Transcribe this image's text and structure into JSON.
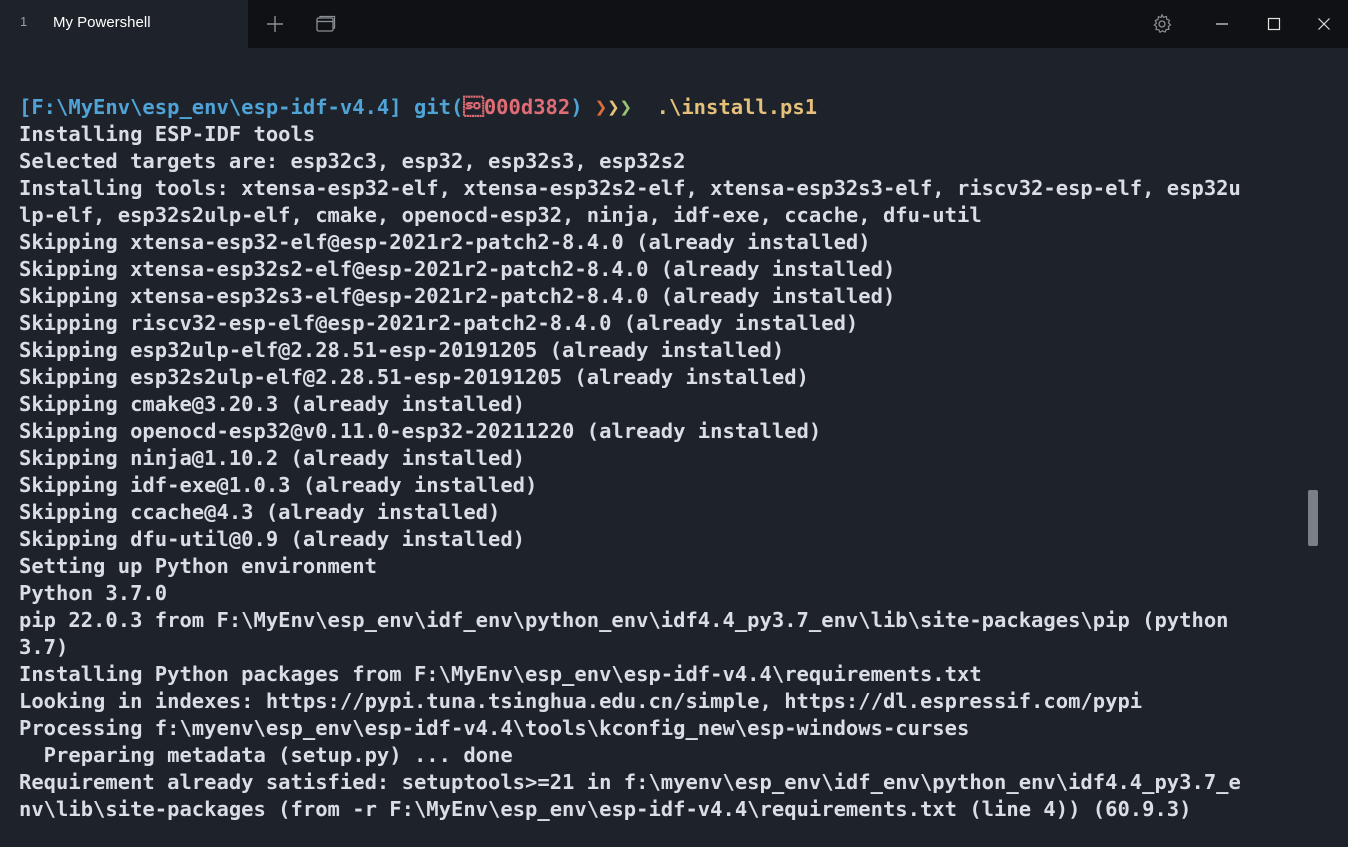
{
  "tab": {
    "index": "1",
    "title": "My Powershell"
  },
  "titlebar_icons": [
    "plus-icon",
    "new-window-icon",
    "gear-icon",
    "minimize-icon",
    "maximize-icon",
    "close-icon"
  ],
  "prompt": {
    "path": "[F:\\MyEnv\\esp_env\\esp-idf-v4.4]",
    "branch_prefix": " git(",
    "branch_hash": "\u000e000d382",
    "branch_suffix": ")",
    "arrow1": " ❯",
    "arrow2": "❯",
    "arrow3": "❯",
    "command": "  .\\install.ps1"
  },
  "output_lines": [
    "Installing ESP-IDF tools",
    "Selected targets are: esp32c3, esp32, esp32s3, esp32s2",
    "Installing tools: xtensa-esp32-elf, xtensa-esp32s2-elf, xtensa-esp32s3-elf, riscv32-esp-elf, esp32u",
    "lp-elf, esp32s2ulp-elf, cmake, openocd-esp32, ninja, idf-exe, ccache, dfu-util",
    "Skipping xtensa-esp32-elf@esp-2021r2-patch2-8.4.0 (already installed)",
    "Skipping xtensa-esp32s2-elf@esp-2021r2-patch2-8.4.0 (already installed)",
    "Skipping xtensa-esp32s3-elf@esp-2021r2-patch2-8.4.0 (already installed)",
    "Skipping riscv32-esp-elf@esp-2021r2-patch2-8.4.0 (already installed)",
    "Skipping esp32ulp-elf@2.28.51-esp-20191205 (already installed)",
    "Skipping esp32s2ulp-elf@2.28.51-esp-20191205 (already installed)",
    "Skipping cmake@3.20.3 (already installed)",
    "Skipping openocd-esp32@v0.11.0-esp32-20211220 (already installed)",
    "Skipping ninja@1.10.2 (already installed)",
    "Skipping idf-exe@1.0.3 (already installed)",
    "Skipping ccache@4.3 (already installed)",
    "Skipping dfu-util@0.9 (already installed)",
    "Setting up Python environment",
    "Python 3.7.0",
    "pip 22.0.3 from F:\\MyEnv\\esp_env\\idf_env\\python_env\\idf4.4_py3.7_env\\lib\\site-packages\\pip (python",
    "3.7)",
    "Installing Python packages from F:\\MyEnv\\esp_env\\esp-idf-v4.4\\requirements.txt",
    "Looking in indexes: https://pypi.tuna.tsinghua.edu.cn/simple, https://dl.espressif.com/pypi",
    "Processing f:\\myenv\\esp_env\\esp-idf-v4.4\\tools\\kconfig_new\\esp-windows-curses",
    "  Preparing metadata (setup.py) ... done",
    "Requirement already satisfied: setuptools>=21 in f:\\myenv\\esp_env\\idf_env\\python_env\\idf4.4_py3.7_e",
    "nv\\lib\\site-packages (from -r F:\\MyEnv\\esp_env\\esp-idf-v4.4\\requirements.txt (line 4)) (60.9.3)"
  ],
  "colors": {
    "background": "#1e232b",
    "titlebar": "#101114",
    "text": "#dadde3",
    "path": "#4fa3d6",
    "hash": "#e06c75",
    "command": "#e5c07b"
  }
}
